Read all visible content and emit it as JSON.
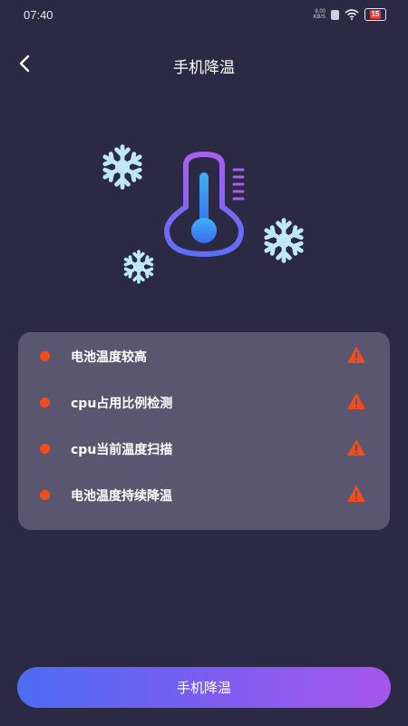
{
  "status_bar": {
    "time": "07:40",
    "net_speed_value": "8.00",
    "net_speed_unit": "KB/S",
    "battery_level": "15"
  },
  "header": {
    "title": "手机降温",
    "back_icon": "chevron-left-icon"
  },
  "hero": {
    "icons": [
      "snowflake-icon",
      "thermometer-icon",
      "snowflake-icon",
      "snowflake-icon"
    ]
  },
  "checklist": {
    "items": [
      {
        "label": "电池温度较高",
        "status_icon": "warning-icon"
      },
      {
        "label": "cpu占用比例检测",
        "status_icon": "warning-icon"
      },
      {
        "label": "cpu当前温度扫描",
        "status_icon": "warning-icon"
      },
      {
        "label": "电池温度持续降温",
        "status_icon": "warning-icon"
      }
    ]
  },
  "action": {
    "button_label": "手机降温"
  },
  "colors": {
    "background": "#2c2944",
    "card": "#5a5670",
    "dot": "#f24b1c",
    "warning": "#f24b1c",
    "button_start": "#4d6cf2",
    "button_end": "#a657ea",
    "snowflake": "#bfe8f7"
  }
}
